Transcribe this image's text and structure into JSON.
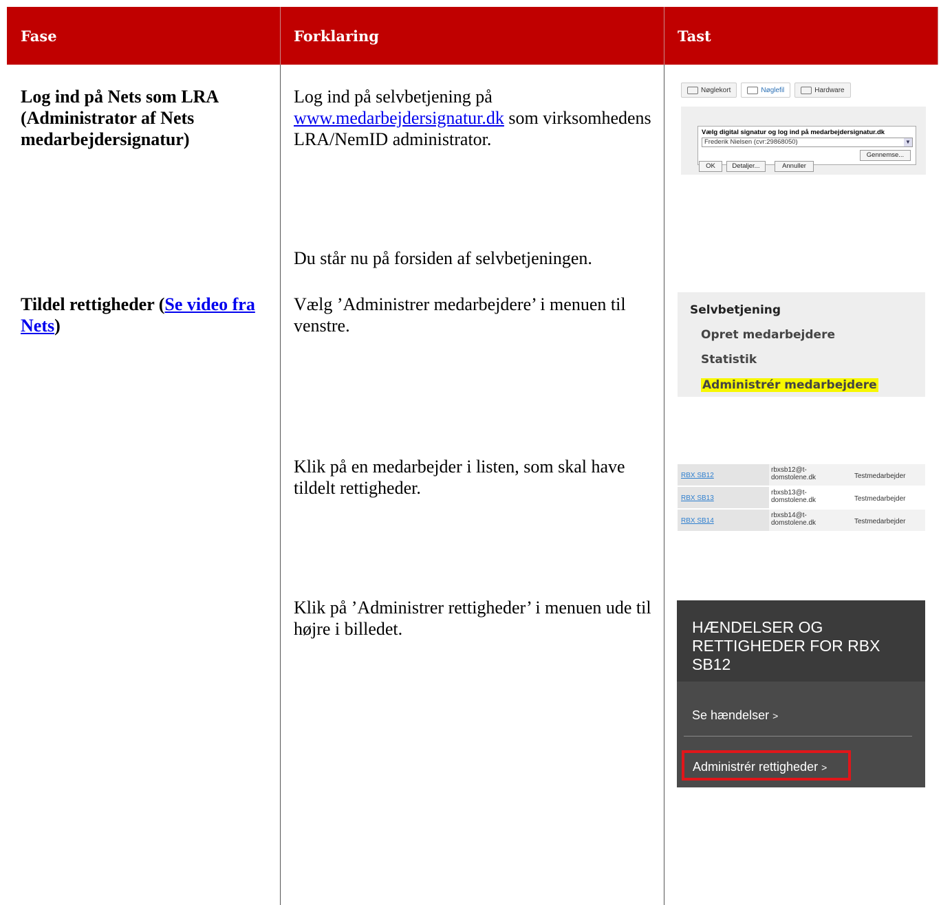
{
  "table": {
    "headers": {
      "fase": "Fase",
      "forklaring": "Forklaring",
      "tast": "Tast"
    }
  },
  "row1": {
    "fase": "Log ind på Nets som LRA (Administrator af Nets medarbejdersignatur)",
    "expl_a": "Log ind på selvbetjening på ",
    "expl_link": "www.medarbejdersignatur.dk",
    "expl_b": " som virksomhedens LRA/NemID administrator.",
    "expl_2": "Du står nu på forsiden af selvbetjeningen."
  },
  "row2": {
    "fase_a": "Tildel rettigheder (",
    "fase_link": "Se video fra Nets",
    "fase_b": ")",
    "step1": "Vælg ’Administrer medarbejdere’ i menuen til venstre.",
    "step2": "Klik på en medarbejder i listen, som skal have tildelt rettigheder.",
    "step3": "Klik på ’Administrer rettigheder’ i menuen ude til højre i billedet."
  },
  "shot_login": {
    "tabs": [
      "Nøglekort",
      "Nøglefil",
      "Hardware"
    ],
    "dialog_title": "Vælg digital signatur og log ind på medarbejdersignatur.dk",
    "selected": "Frederik Nielsen (cvr:29868050)",
    "browse": "Gennemse...",
    "ok": "OK",
    "details": "Detaljer...",
    "cancel": "Annuller"
  },
  "shot_menu": {
    "heading": "Selvbetjening",
    "items": [
      "Opret medarbejdere",
      "Statistik",
      "Administrér medarbejdere"
    ]
  },
  "shot_list": {
    "rows": [
      {
        "name": "RBX SB12",
        "email": "rbxsb12@t-domstolene.dk",
        "type": "Testmedarbejder"
      },
      {
        "name": "RBX SB13",
        "email": "rbxsb13@t-domstolene.dk",
        "type": "Testmedarbejder"
      },
      {
        "name": "RBX SB14",
        "email": "rbxsb14@t-domstolene.dk",
        "type": "Testmedarbejder"
      }
    ]
  },
  "shot_panel": {
    "title": "HÆNDELSER OG RETTIGHEDER FOR RBX SB12",
    "link1": "Se hændelser",
    "link2": "Administrér rettigheder",
    "arrow": ">"
  },
  "colors": {
    "header": "#c00000",
    "link": "#0000ee",
    "highlight": "#f7f700",
    "alert_box": "#e0161a"
  }
}
